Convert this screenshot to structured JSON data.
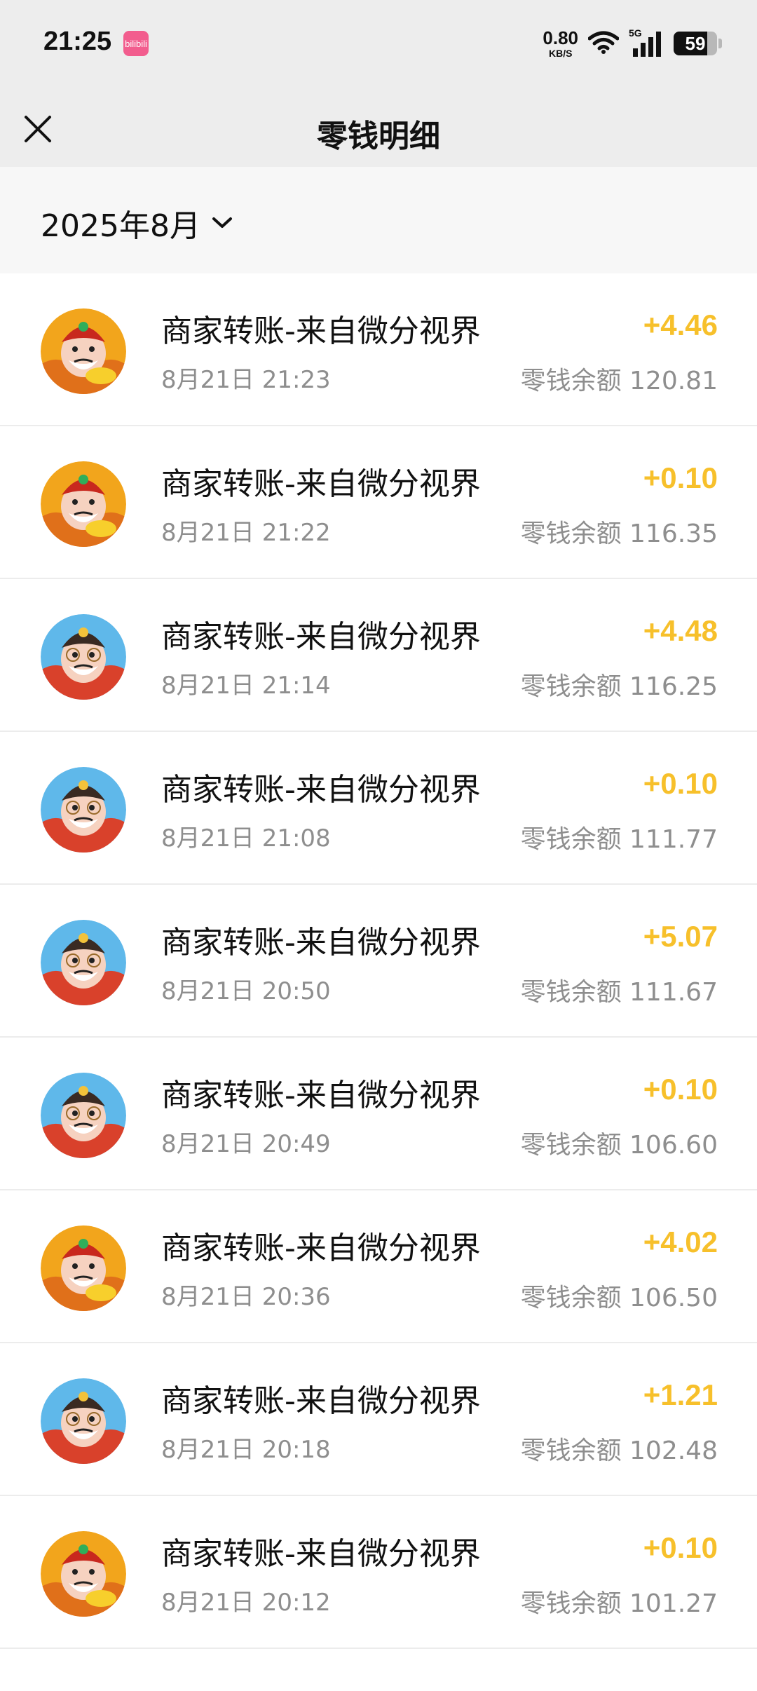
{
  "status_bar": {
    "time": "21:25",
    "app_badge": "bilibili",
    "net_speed_value": "0.80",
    "net_speed_unit": "KB/S",
    "network": "5G",
    "battery": "59",
    "battery_level": 0.59
  },
  "header": {
    "title": "零钱明细",
    "close_icon": "close-icon"
  },
  "filter": {
    "month": "2025年8月",
    "dropdown_icon": "chevron-down-icon"
  },
  "colors": {
    "amount": "#f7c02b",
    "secondary_text": "#8e8e8e",
    "header_bg": "#ededed"
  },
  "transactions": [
    {
      "title": "商家转账-来自微分视界",
      "time": "8月21日 21:23",
      "amount": "+4.46",
      "balance": "零钱余额 120.81",
      "avatar": "god-of-wealth-gold"
    },
    {
      "title": "商家转账-来自微分视界",
      "time": "8月21日 21:22",
      "amount": "+0.10",
      "balance": "零钱余额 116.35",
      "avatar": "god-of-wealth-gold"
    },
    {
      "title": "商家转账-来自微分视界",
      "time": "8月21日 21:14",
      "amount": "+4.48",
      "balance": "零钱余额 116.25",
      "avatar": "god-of-wealth-blue"
    },
    {
      "title": "商家转账-来自微分视界",
      "time": "8月21日 21:08",
      "amount": "+0.10",
      "balance": "零钱余额 111.77",
      "avatar": "god-of-wealth-blue"
    },
    {
      "title": "商家转账-来自微分视界",
      "time": "8月21日 20:50",
      "amount": "+5.07",
      "balance": "零钱余额 111.67",
      "avatar": "god-of-wealth-blue"
    },
    {
      "title": "商家转账-来自微分视界",
      "time": "8月21日 20:49",
      "amount": "+0.10",
      "balance": "零钱余额 106.60",
      "avatar": "god-of-wealth-blue"
    },
    {
      "title": "商家转账-来自微分视界",
      "time": "8月21日 20:36",
      "amount": "+4.02",
      "balance": "零钱余额 106.50",
      "avatar": "god-of-wealth-gold"
    },
    {
      "title": "商家转账-来自微分视界",
      "time": "8月21日 20:18",
      "amount": "+1.21",
      "balance": "零钱余额 102.48",
      "avatar": "god-of-wealth-blue"
    },
    {
      "title": "商家转账-来自微分视界",
      "time": "8月21日 20:12",
      "amount": "+0.10",
      "balance": "零钱余额 101.27",
      "avatar": "god-of-wealth-gold"
    }
  ]
}
